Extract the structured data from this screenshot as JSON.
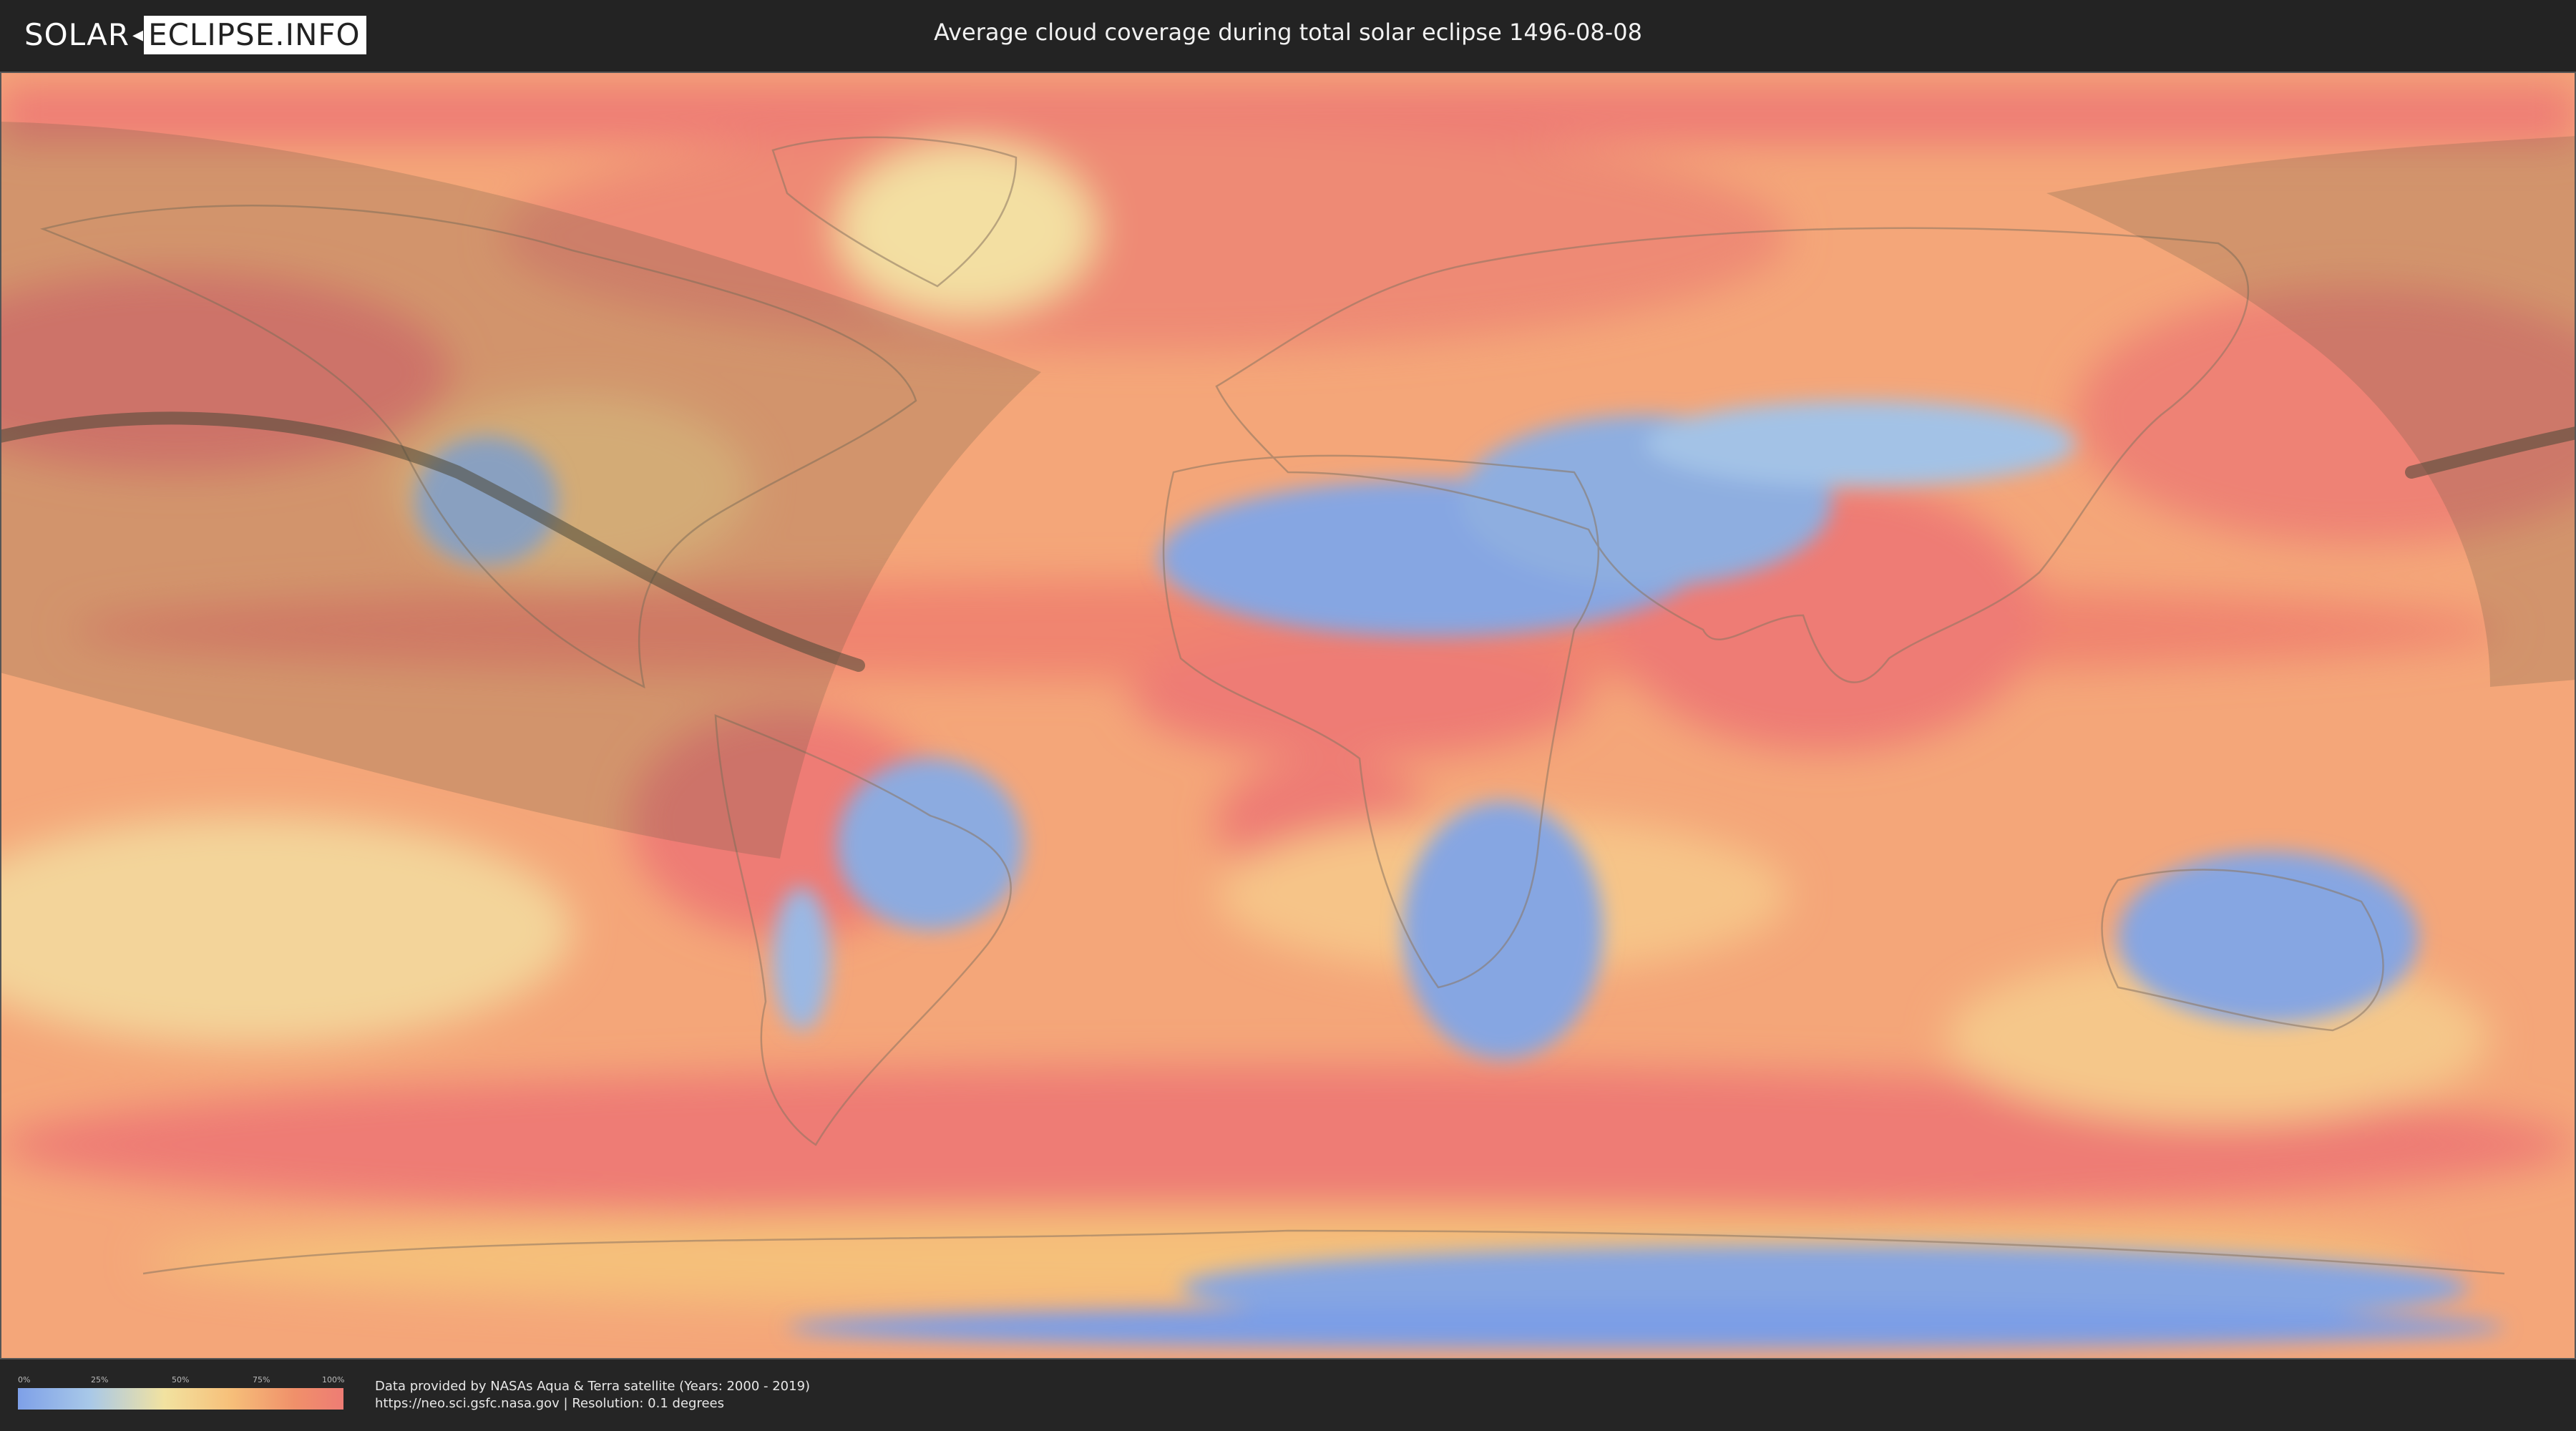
{
  "header": {
    "logo_left": "SOLAR",
    "logo_separator": "◂",
    "logo_right": "ECLIPSE.INFO",
    "title": "Average cloud coverage during total solar eclipse 1496-08-08"
  },
  "map": {
    "projection": "equirectangular",
    "layers": [
      "cloud-coverage",
      "country-borders",
      "eclipse-visibility-zone",
      "totality-path"
    ],
    "colors": {
      "ocean_base": "#f4a679",
      "high_cloud": "#ee7c74",
      "low_cloud": "#7ea0e8",
      "mid_cloud": "#f2e2a0",
      "shadow_zone": "#6e6a52",
      "totality_path": "#4a4736"
    }
  },
  "legend": {
    "ticks": [
      "0%",
      "25%",
      "50%",
      "75%",
      "100%"
    ],
    "gradient_colors": [
      "#7ea0e8",
      "#a8c8e8",
      "#f2e2a0",
      "#f6c07a",
      "#f0906a",
      "#ee7c74"
    ]
  },
  "footer": {
    "credit_line1": "Data provided by NASAs Aqua & Terra satellite (Years: 2000 - 2019)",
    "credit_line2": "https://neo.sci.gsfc.nasa.gov | Resolution: 0.1 degrees"
  }
}
